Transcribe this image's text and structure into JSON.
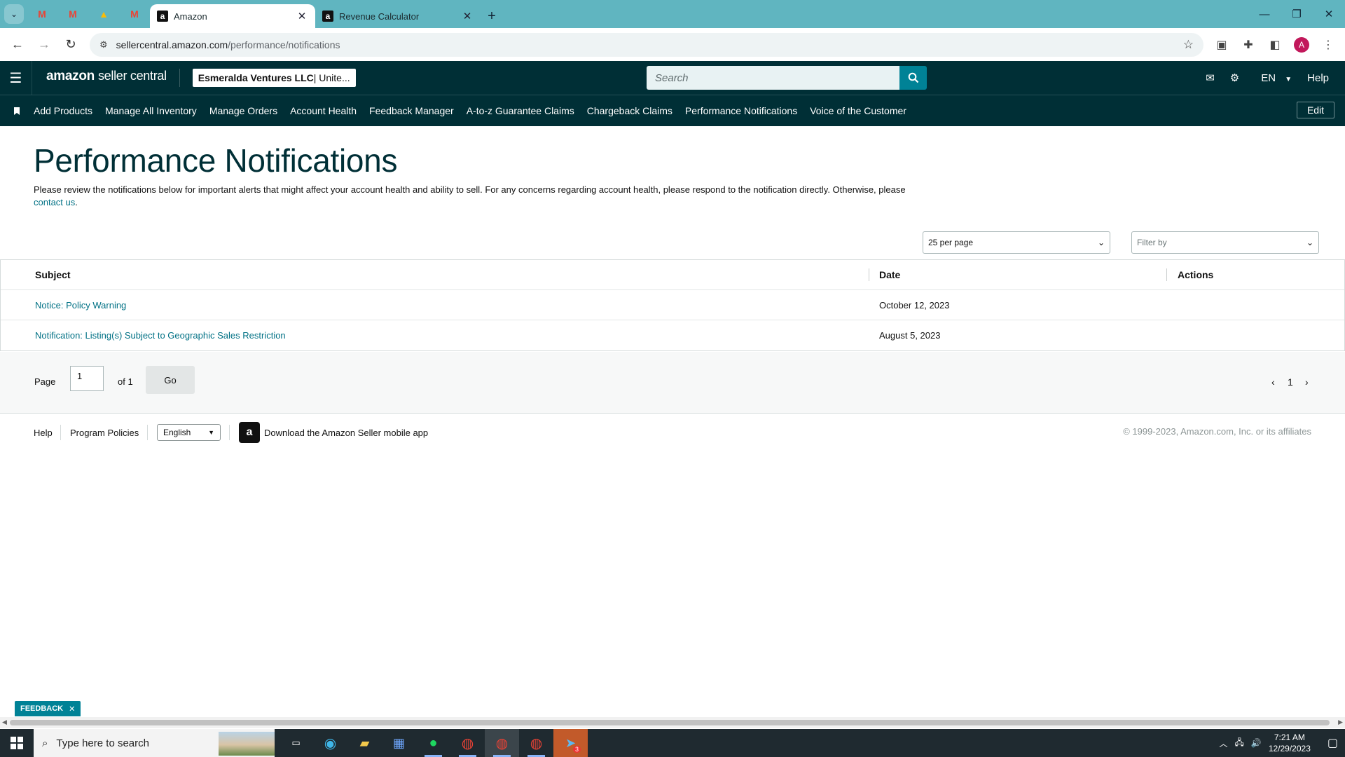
{
  "browser": {
    "tabs": [
      {
        "label": "Amazon",
        "favicon": "a",
        "active": true
      },
      {
        "label": "Revenue Calculator",
        "favicon": "a",
        "active": false
      }
    ],
    "url_host": "sellercentral.amazon.com",
    "url_path": "/performance/notifications",
    "profile_initial": "A"
  },
  "header": {
    "logo_brand": "amazon",
    "logo_product": "seller central",
    "account_name": "Esmeralda Ventures LLC",
    "account_suffix": " | Unite...",
    "search_placeholder": "Search",
    "lang": "EN",
    "help": "Help"
  },
  "nav": {
    "items": [
      "Add Products",
      "Manage All Inventory",
      "Manage Orders",
      "Account Health",
      "Feedback Manager",
      "A-to-z Guarantee Claims",
      "Chargeback Claims",
      "Performance Notifications",
      "Voice of the Customer"
    ],
    "edit": "Edit"
  },
  "page": {
    "title": "Performance Notifications",
    "description": "Please review the notifications below for important alerts that might affect your account health and ability to sell. For any concerns regarding account health, please respond to the notification directly. Otherwise, please ",
    "contact_link": "contact us",
    "description_end": ".",
    "per_page": "25 per page",
    "filter_placeholder": "Filter by"
  },
  "table": {
    "headers": {
      "subject": "Subject",
      "date": "Date",
      "actions": "Actions"
    },
    "rows": [
      {
        "subject": "Notice: Policy Warning",
        "date": "October 12, 2023"
      },
      {
        "subject": "Notification: Listing(s) Subject to Geographic Sales Restriction",
        "date": "August 5, 2023"
      }
    ]
  },
  "pager": {
    "page_label": "Page",
    "page_value": "1",
    "of_label": "of 1",
    "go": "Go",
    "current": "1"
  },
  "footer": {
    "help": "Help",
    "policies": "Program Policies",
    "language": "English",
    "app_link": "Download the Amazon Seller mobile app",
    "copyright": "© 1999-2023, Amazon.com, Inc. or its affiliates"
  },
  "feedback": "FEEDBACK",
  "taskbar": {
    "search_placeholder": "Type here to search",
    "time": "7:21 AM",
    "date": "12/29/2023",
    "badge": "3"
  },
  "colors": {
    "tabstrip": "#60b5c0",
    "header": "#002f36",
    "link": "#007185",
    "accent": "#008296"
  }
}
